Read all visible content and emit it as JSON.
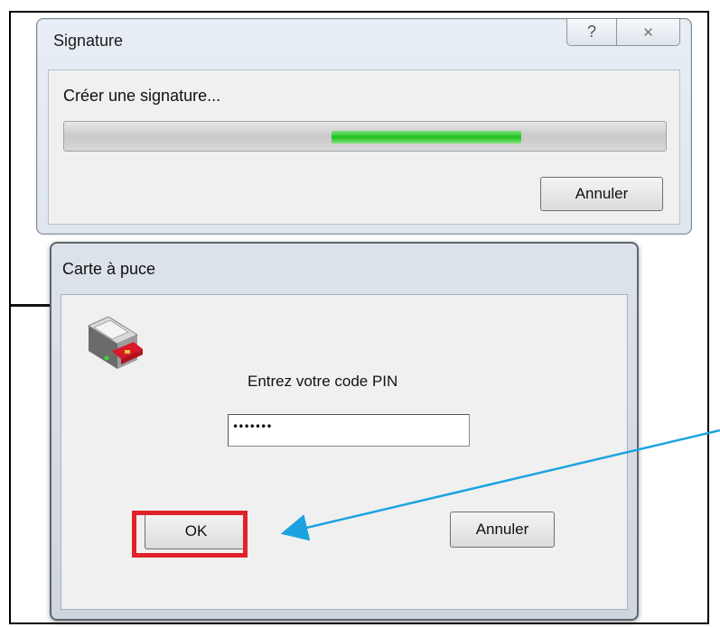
{
  "signature_window": {
    "title": "Signature",
    "help_glyph": "?",
    "close_glyph": "✕",
    "status": "Créer une signature...",
    "progress_shown": "indeterminate",
    "cancel_label": "Annuler"
  },
  "smartcard_window": {
    "title": "Carte à puce",
    "icon": "smart-card-reader-icon",
    "prompt": "Entrez votre code PIN",
    "pin_value": "•••••••",
    "ok_label": "OK",
    "cancel_label": "Annuler"
  },
  "annotation": {
    "highlight_color": "#e0232a",
    "arrow_color": "#1aa3e0",
    "target": "OK button"
  },
  "colors": {
    "progress_green": "#1fc31f",
    "window_frame": "#dde3ea"
  }
}
